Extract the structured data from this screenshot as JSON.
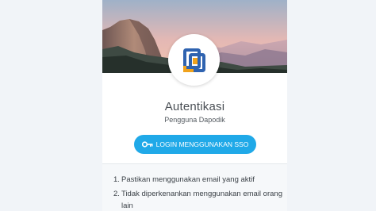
{
  "auth": {
    "title": "Autentikasi",
    "subtitle": "Pengguna Dapodik",
    "sso_button_label": "LOGIN MENGGUNAKAN SSO"
  },
  "notes": [
    {
      "number": "1.",
      "text": "Pastikan menggunakan email yang aktif"
    },
    {
      "number": "2.",
      "text": "Tidak diperkenankan menggunakan email orang lain"
    }
  ],
  "icons": {
    "logo": "dapodik-logo-icon",
    "key": "key-icon"
  },
  "colors": {
    "button": "#20a9e8",
    "logo_blue": "#2f63b0",
    "logo_orange": "#f0a21c"
  }
}
